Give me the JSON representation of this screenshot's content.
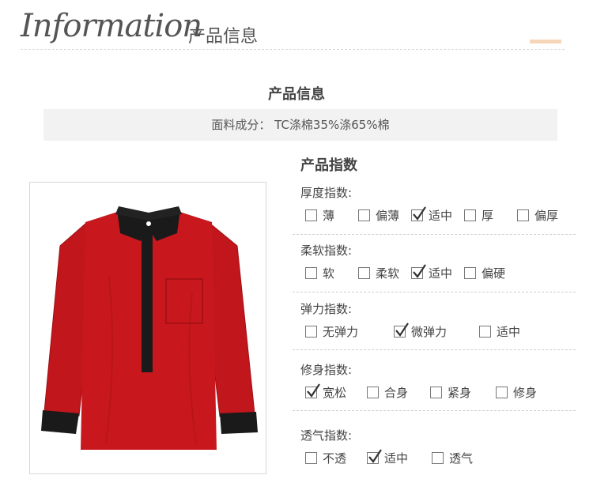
{
  "header": {
    "script_title": "Information",
    "title": "产品信息"
  },
  "product_info": {
    "title": "产品信息",
    "fabric": "面料成分：  TC涤棉35%涤65%棉"
  },
  "product_index": {
    "title": "产品指数",
    "groups": [
      {
        "label": "厚度指数:",
        "options": [
          {
            "text": "薄",
            "checked": false
          },
          {
            "text": "偏薄",
            "checked": false
          },
          {
            "text": "适中",
            "checked": true
          },
          {
            "text": "厚",
            "checked": false
          },
          {
            "text": "偏厚",
            "checked": false
          }
        ]
      },
      {
        "label": "柔软指数:",
        "options": [
          {
            "text": "软",
            "checked": false
          },
          {
            "text": "柔软",
            "checked": false
          },
          {
            "text": "适中",
            "checked": true
          },
          {
            "text": "偏硬",
            "checked": false
          }
        ]
      },
      {
        "label": "弹力指数:",
        "options": [
          {
            "text": "无弹力",
            "checked": false
          },
          {
            "text": "微弹力",
            "checked": true
          },
          {
            "text": "适中",
            "checked": false
          }
        ]
      },
      {
        "label": "修身指数:",
        "options": [
          {
            "text": "宽松",
            "checked": true
          },
          {
            "text": "合身",
            "checked": false
          },
          {
            "text": "紧身",
            "checked": false
          },
          {
            "text": "修身",
            "checked": false
          }
        ]
      },
      {
        "label": "透气指数:",
        "options": [
          {
            "text": "不透",
            "checked": false
          },
          {
            "text": "适中",
            "checked": true
          },
          {
            "text": "透气",
            "checked": false
          }
        ]
      }
    ]
  },
  "colors": {
    "shirt": "#c0161c",
    "collar": "#1a1a1a",
    "accent": "#f6d6b8"
  },
  "icons": {
    "product_image": "red-shirt-with-black-collar"
  }
}
